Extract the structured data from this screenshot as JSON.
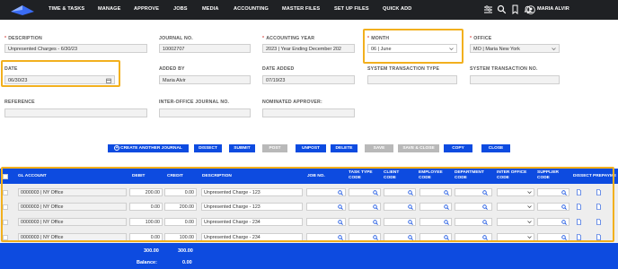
{
  "nav": {
    "items": [
      "TIME & TASKS",
      "MANAGE",
      "APPROVE",
      "JOBS",
      "MEDIA",
      "ACCOUNTING",
      "MASTER FILES",
      "SET UP FILES",
      "QUICK ADD"
    ],
    "user": "MARIA ALVIR"
  },
  "form": {
    "description": {
      "label": "DESCRIPTION",
      "value": "Unpresented Charges - 6/30/23"
    },
    "journal_no": {
      "label": "JOURNAL NO.",
      "value": "10002707"
    },
    "accounting_year": {
      "label": "ACCOUNTING YEAR",
      "value": "2023 | Year Ending December 202"
    },
    "month": {
      "label": "MONTH",
      "value": "06 | June"
    },
    "office": {
      "label": "OFFICE",
      "value": "MO | Maria New York"
    },
    "date": {
      "label": "DATE",
      "value": "06/30/23"
    },
    "added_by": {
      "label": "ADDED BY",
      "value": "Maria Alvir"
    },
    "date_added": {
      "label": "DATE ADDED",
      "value": "07/19/23"
    },
    "system_transaction_type": {
      "label": "SYSTEM TRANSACTION TYPE",
      "value": ""
    },
    "system_transaction_no": {
      "label": "SYSTEM TRANSACTION NO.",
      "value": ""
    },
    "reference": {
      "label": "REFERENCE",
      "value": ""
    },
    "inter_office_journal_no": {
      "label": "INTER-OFFICE JOURNAL NO.",
      "value": ""
    },
    "nominated_approver": {
      "label": "NOMINATED APPROVER:",
      "value": ""
    }
  },
  "actions": {
    "create_another": "CREATE ANOTHER JOURNAL",
    "dissect": "DISSECT",
    "submit": "SUBMIT",
    "post": "POST",
    "unpost": "UNPOST",
    "delete": "DELETE",
    "save": "SAVE",
    "save_close": "SAVE & CLOSE",
    "copy": "COPY",
    "close": "CLOSE"
  },
  "grid": {
    "headers": {
      "gl_account": "GL ACCOUNT",
      "debit": "DEBIT",
      "credit": "CREDIT",
      "description": "DESCRIPTION",
      "job_no": "JOB NO.",
      "task_type_1": "TASK TYPE",
      "task_type_2": "CODE",
      "client_1": "CLIENT",
      "client_2": "CODE",
      "employee_1": "EMPLOYEE",
      "employee_2": "CODE",
      "department_1": "DEPARTMENT",
      "department_2": "CODE",
      "inter_office_1": "INTER OFFICE",
      "inter_office_2": "CODE",
      "supplier_1": "SUPPLIER",
      "supplier_2": "CODE",
      "dissect": "DISSECT",
      "prepayment": "PREPAYME"
    },
    "rows": [
      {
        "gl_account": "0000003 | NY Office",
        "debit": "200.00",
        "credit": "0.00",
        "description": "Unpresented Charge - 123"
      },
      {
        "gl_account": "0000003 | NY Office",
        "debit": "0.00",
        "credit": "200.00",
        "description": "Unpresented Charge - 123"
      },
      {
        "gl_account": "0000003 | NY Office",
        "debit": "100.00",
        "credit": "0.00",
        "description": "Unpresented Charge - 234"
      },
      {
        "gl_account": "0000003 | NY Office",
        "debit": "0.00",
        "credit": "100.00",
        "description": "Unpresented Charge - 234"
      }
    ],
    "totals": {
      "debit": "300.00",
      "credit": "300.00",
      "balance_label": "Balance:",
      "balance": "0.00"
    }
  },
  "colors": {
    "accent": "#0d4be0",
    "highlight": "#f2b01e",
    "topbar": "#1f2124"
  }
}
